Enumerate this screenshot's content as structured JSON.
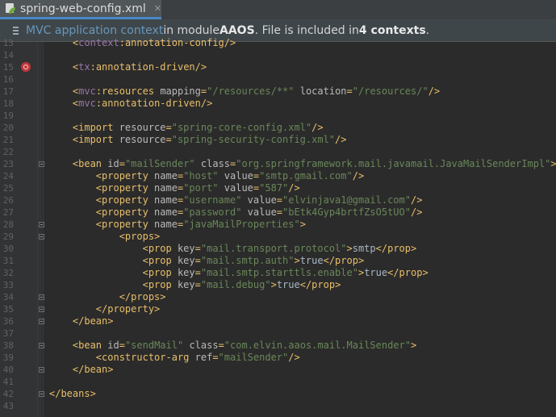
{
  "tab": {
    "title": "spring-web-config.xml",
    "close": "✕",
    "icon": "spring-xml-file-icon"
  },
  "banner": {
    "link": "MVC application context",
    "in_module": " in module ",
    "module": "AAOS",
    "file_included": ". File is included in ",
    "contexts": "4 contexts",
    "period": "."
  },
  "colors": {
    "tag": "#e8bf6a",
    "namespace": "#9876aa",
    "attribute": "#bababa",
    "value": "#6a8759",
    "text": "#a9b7c6",
    "link": "#6897bb"
  },
  "lines": [
    {
      "n": "13",
      "indent": "    ",
      "parts": [
        [
          "t",
          "<"
        ],
        [
          "ns",
          "context"
        ],
        [
          "t",
          ":annotation-config/>"
        ]
      ]
    },
    {
      "n": "14",
      "indent": "",
      "parts": []
    },
    {
      "n": "15",
      "indent": "    ",
      "marker": true,
      "parts": [
        [
          "t",
          "<"
        ],
        [
          "ns",
          "tx"
        ],
        [
          "t",
          ":annotation-driven/>"
        ]
      ]
    },
    {
      "n": "16",
      "indent": "",
      "parts": []
    },
    {
      "n": "17",
      "indent": "    ",
      "parts": [
        [
          "t",
          "<"
        ],
        [
          "ns",
          "mvc"
        ],
        [
          "t",
          ":resources "
        ],
        [
          "a",
          "mapping"
        ],
        [
          "t",
          "="
        ],
        [
          "v",
          "\"/resources/**\""
        ],
        [
          "t",
          " "
        ],
        [
          "a",
          "location"
        ],
        [
          "t",
          "="
        ],
        [
          "v",
          "\"/resources/\""
        ],
        [
          "t",
          "/>"
        ]
      ]
    },
    {
      "n": "18",
      "indent": "    ",
      "parts": [
        [
          "t",
          "<"
        ],
        [
          "ns",
          "mvc"
        ],
        [
          "t",
          ":annotation-driven/>"
        ]
      ]
    },
    {
      "n": "19",
      "indent": "",
      "parts": []
    },
    {
      "n": "20",
      "indent": "    ",
      "parts": [
        [
          "t",
          "<import "
        ],
        [
          "a",
          "resource"
        ],
        [
          "t",
          "="
        ],
        [
          "v",
          "\"spring-core-config.xml\""
        ],
        [
          "t",
          "/>"
        ]
      ]
    },
    {
      "n": "21",
      "indent": "    ",
      "parts": [
        [
          "t",
          "<import "
        ],
        [
          "a",
          "resource"
        ],
        [
          "t",
          "="
        ],
        [
          "v",
          "\"spring-security-config.xml\""
        ],
        [
          "t",
          "/>"
        ]
      ]
    },
    {
      "n": "22",
      "indent": "",
      "parts": []
    },
    {
      "n": "23",
      "indent": "    ",
      "fold": true,
      "parts": [
        [
          "t",
          "<bean "
        ],
        [
          "a",
          "id"
        ],
        [
          "t",
          "="
        ],
        [
          "v",
          "\"mailSender\""
        ],
        [
          "t",
          " "
        ],
        [
          "a",
          "class"
        ],
        [
          "t",
          "="
        ],
        [
          "v",
          "\"org.springframework.mail.javamail.JavaMailSenderImpl\""
        ],
        [
          "t",
          ">"
        ]
      ]
    },
    {
      "n": "24",
      "indent": "        ",
      "parts": [
        [
          "t",
          "<property "
        ],
        [
          "a",
          "name"
        ],
        [
          "t",
          "="
        ],
        [
          "v",
          "\"host\""
        ],
        [
          "t",
          " "
        ],
        [
          "a",
          "value"
        ],
        [
          "t",
          "="
        ],
        [
          "v",
          "\"smtp.gmail.com\""
        ],
        [
          "t",
          "/>"
        ]
      ]
    },
    {
      "n": "25",
      "indent": "        ",
      "parts": [
        [
          "t",
          "<property "
        ],
        [
          "a",
          "name"
        ],
        [
          "t",
          "="
        ],
        [
          "v",
          "\"port\""
        ],
        [
          "t",
          " "
        ],
        [
          "a",
          "value"
        ],
        [
          "t",
          "="
        ],
        [
          "v",
          "\"587\""
        ],
        [
          "t",
          "/>"
        ]
      ]
    },
    {
      "n": "26",
      "indent": "        ",
      "parts": [
        [
          "t",
          "<property "
        ],
        [
          "a",
          "name"
        ],
        [
          "t",
          "="
        ],
        [
          "v",
          "\"username\""
        ],
        [
          "t",
          " "
        ],
        [
          "a",
          "value"
        ],
        [
          "t",
          "="
        ],
        [
          "v",
          "\"elvinjava1@gmail.com\""
        ],
        [
          "t",
          "/>"
        ]
      ]
    },
    {
      "n": "27",
      "indent": "        ",
      "parts": [
        [
          "t",
          "<property "
        ],
        [
          "a",
          "name"
        ],
        [
          "t",
          "="
        ],
        [
          "v",
          "\"password\""
        ],
        [
          "t",
          " "
        ],
        [
          "a",
          "value"
        ],
        [
          "t",
          "="
        ],
        [
          "v",
          "\"bEtk4Gyp4brtfZsO5tUO\""
        ],
        [
          "t",
          "/>"
        ]
      ]
    },
    {
      "n": "28",
      "indent": "        ",
      "fold": true,
      "parts": [
        [
          "t",
          "<property "
        ],
        [
          "a",
          "name"
        ],
        [
          "t",
          "="
        ],
        [
          "v",
          "\"javaMailProperties\""
        ],
        [
          "t",
          ">"
        ]
      ]
    },
    {
      "n": "29",
      "indent": "            ",
      "fold": true,
      "parts": [
        [
          "t",
          "<props>"
        ]
      ]
    },
    {
      "n": "30",
      "indent": "                ",
      "parts": [
        [
          "t",
          "<prop "
        ],
        [
          "a",
          "key"
        ],
        [
          "t",
          "="
        ],
        [
          "v",
          "\"mail.transport.protocol\""
        ],
        [
          "t",
          ">"
        ],
        [
          "tx",
          "smtp"
        ],
        [
          "t",
          "</prop>"
        ]
      ]
    },
    {
      "n": "31",
      "indent": "                ",
      "parts": [
        [
          "t",
          "<prop "
        ],
        [
          "a",
          "key"
        ],
        [
          "t",
          "="
        ],
        [
          "v",
          "\"mail.smtp.auth\""
        ],
        [
          "t",
          ">"
        ],
        [
          "tx",
          "true"
        ],
        [
          "t",
          "</prop>"
        ]
      ]
    },
    {
      "n": "32",
      "indent": "                ",
      "parts": [
        [
          "t",
          "<prop "
        ],
        [
          "a",
          "key"
        ],
        [
          "t",
          "="
        ],
        [
          "v",
          "\"mail.smtp.starttls.enable\""
        ],
        [
          "t",
          ">"
        ],
        [
          "tx",
          "true"
        ],
        [
          "t",
          "</prop>"
        ]
      ]
    },
    {
      "n": "33",
      "indent": "                ",
      "parts": [
        [
          "t",
          "<prop "
        ],
        [
          "a",
          "key"
        ],
        [
          "t",
          "="
        ],
        [
          "v",
          "\"mail.debug\""
        ],
        [
          "t",
          ">"
        ],
        [
          "tx",
          "true"
        ],
        [
          "t",
          "</prop>"
        ]
      ]
    },
    {
      "n": "34",
      "indent": "            ",
      "fold": true,
      "parts": [
        [
          "t",
          "</props>"
        ]
      ]
    },
    {
      "n": "35",
      "indent": "        ",
      "fold": true,
      "parts": [
        [
          "t",
          "</property>"
        ]
      ]
    },
    {
      "n": "36",
      "indent": "    ",
      "fold": true,
      "parts": [
        [
          "t",
          "</bean>"
        ]
      ]
    },
    {
      "n": "37",
      "indent": "",
      "parts": []
    },
    {
      "n": "38",
      "indent": "    ",
      "fold": true,
      "parts": [
        [
          "t",
          "<bean "
        ],
        [
          "a",
          "id"
        ],
        [
          "t",
          "="
        ],
        [
          "v",
          "\"sendMail\""
        ],
        [
          "t",
          " "
        ],
        [
          "a",
          "class"
        ],
        [
          "t",
          "="
        ],
        [
          "v",
          "\"com.elvin.aaos.mail.MailSender\""
        ],
        [
          "t",
          ">"
        ]
      ]
    },
    {
      "n": "39",
      "indent": "        ",
      "parts": [
        [
          "t",
          "<constructor-arg "
        ],
        [
          "a",
          "ref"
        ],
        [
          "t",
          "="
        ],
        [
          "v",
          "\"mailSender\""
        ],
        [
          "t",
          "/>"
        ]
      ]
    },
    {
      "n": "40",
      "indent": "    ",
      "fold": true,
      "parts": [
        [
          "t",
          "</bean>"
        ]
      ]
    },
    {
      "n": "41",
      "indent": "",
      "parts": []
    },
    {
      "n": "42",
      "indent": "",
      "fold": true,
      "parts": [
        [
          "t",
          "</beans>"
        ]
      ]
    },
    {
      "n": "43",
      "indent": "",
      "parts": []
    }
  ]
}
